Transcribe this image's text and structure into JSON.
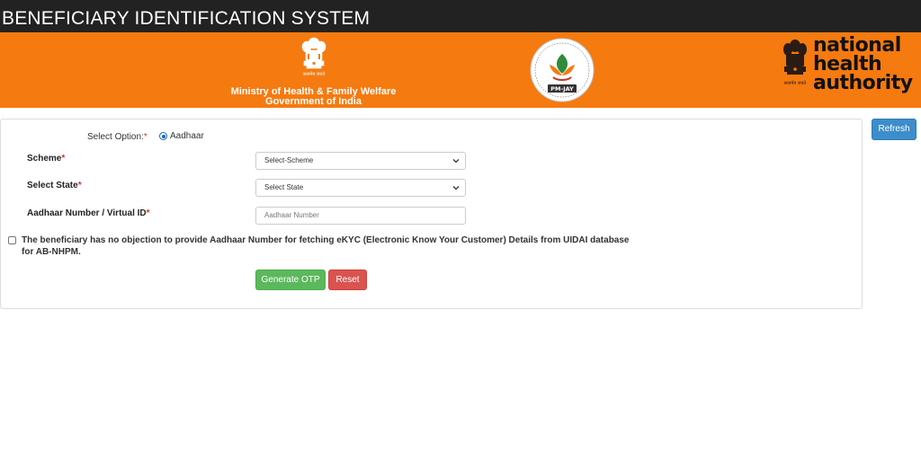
{
  "header": {
    "title": "BENEFICIARY IDENTIFICATION SYSTEM"
  },
  "banner": {
    "ministry_line1": "Ministry of Health & Family Welfare",
    "ministry_line2": "Government of India",
    "pmjay_label": "PM-JAY",
    "nha_line1": "national",
    "nha_line2": "health",
    "nha_line3": "authority",
    "colors": {
      "banner": "#f57a10",
      "topbar": "#222222"
    }
  },
  "form": {
    "select_option_label": "Select Option:",
    "required_mark": "*",
    "radio_option": "Aadhaar",
    "scheme_label": "Scheme",
    "scheme_value": "Select-Scheme",
    "state_label": "Select State",
    "state_value": "Select State",
    "aadhaar_label": "Aadhaar Number / Virtual ID",
    "aadhaar_placeholder": "Aadhaar Number",
    "consent_text": "The beneficiary has no objection to provide Aadhaar Number for fetching eKYC (Electronic Know Your Customer) Details from UIDAI database for AB-NHPM."
  },
  "buttons": {
    "refresh": "Refresh",
    "generate_otp": "Generate OTP",
    "reset": "Reset"
  },
  "icons": {
    "emblem": "state-emblem-icon",
    "pmjay": "pmjay-logo-icon",
    "dropdown": "chevron-down-icon"
  }
}
